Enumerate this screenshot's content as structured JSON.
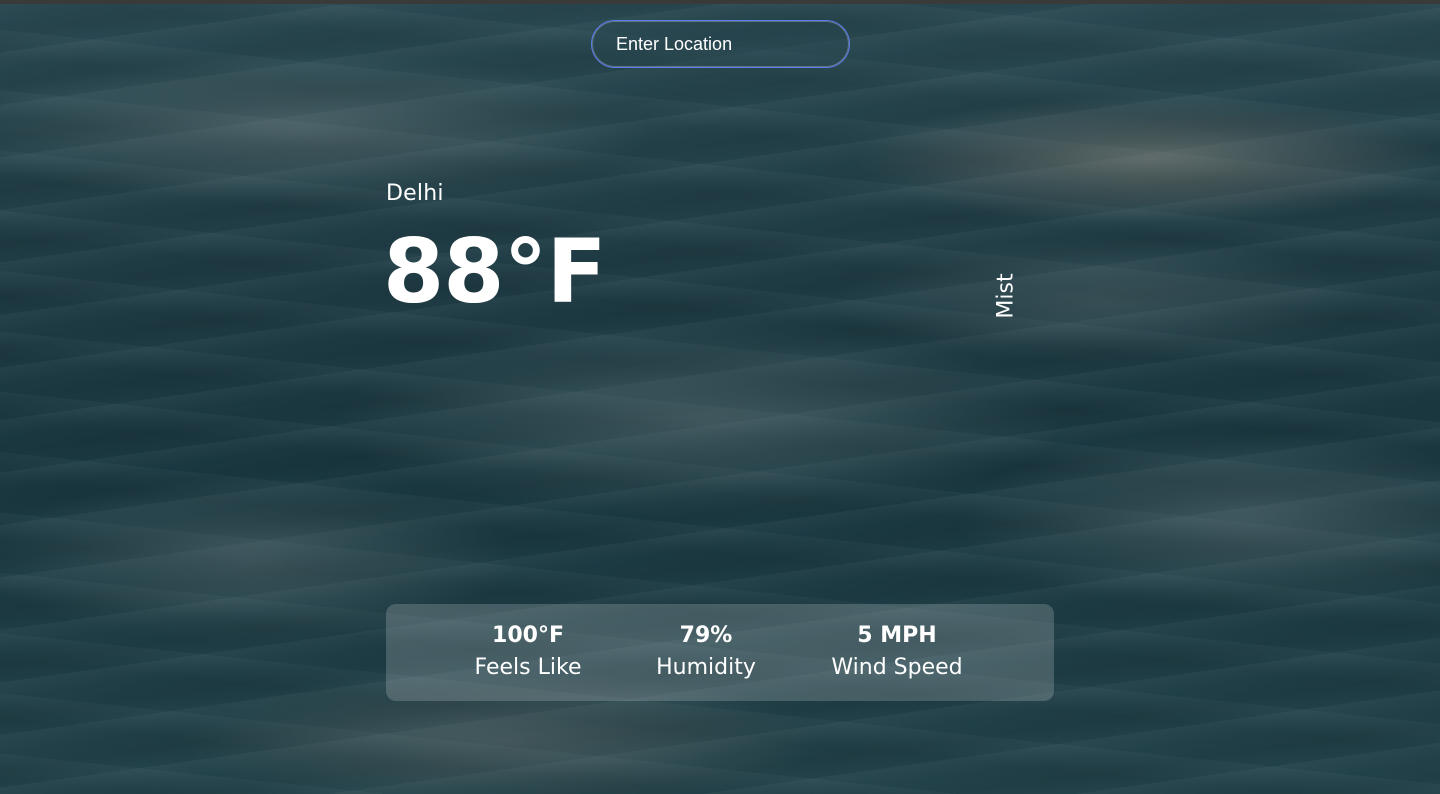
{
  "search": {
    "placeholder": "Enter Location",
    "value": ""
  },
  "weather": {
    "location": "Delhi",
    "temperature": "88°F",
    "condition": "Mist"
  },
  "stats": {
    "feels_like_value": "100°F",
    "feels_like_label": "Feels Like",
    "humidity_value": "79%",
    "humidity_label": "Humidity",
    "wind_value": "5 MPH",
    "wind_label": "Wind Speed"
  },
  "colors": {
    "search_border": "#5b7cf0",
    "text": "#ffffff",
    "background_water": "#1f3c45"
  }
}
